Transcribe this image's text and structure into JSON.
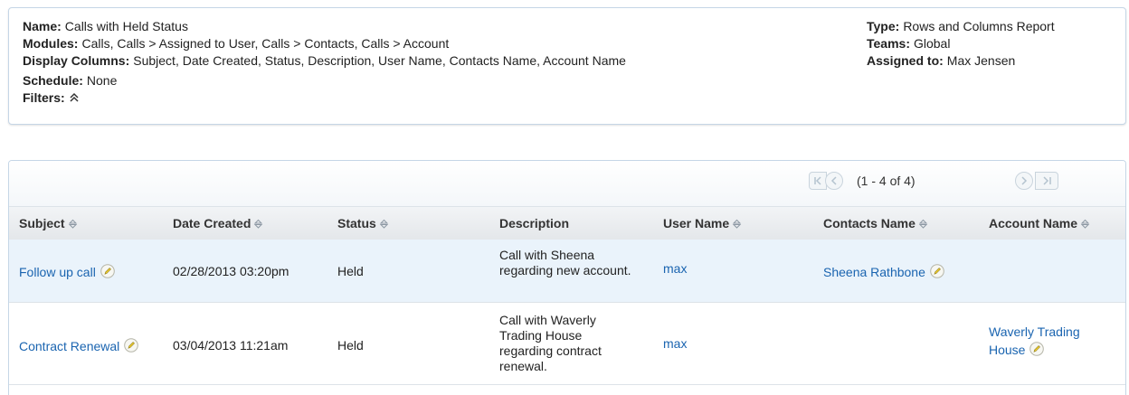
{
  "details": {
    "name_label": "Name:",
    "name": "Calls with Held Status",
    "modules_label": "Modules:",
    "modules": "Calls, Calls > Assigned to User, Calls > Contacts, Calls > Account",
    "display_columns_label": "Display Columns:",
    "display_columns": "Subject, Date Created, Status, Description, User Name, Contacts Name, Account Name",
    "schedule_label": "Schedule:",
    "schedule": "None",
    "filters_label": "Filters:",
    "type_label": "Type:",
    "type": "Rows and Columns Report",
    "teams_label": "Teams:",
    "teams": "Global",
    "assigned_label": "Assigned to:",
    "assigned": "Max Jensen"
  },
  "pager": {
    "range": "(1 - 4 of 4)",
    "first_icon": "first-page-icon",
    "prev_icon": "previous-page-icon",
    "next_icon": "next-page-icon",
    "last_icon": "last-page-icon"
  },
  "columns": {
    "subject": "Subject",
    "date_created": "Date Created",
    "status": "Status",
    "description": "Description",
    "user_name": "User Name",
    "contacts_name": "Contacts Name",
    "account_name": "Account Name"
  },
  "rows": [
    {
      "subject": "Follow up call",
      "date_created": "02/28/2013 03:20pm",
      "status": "Held",
      "description": "Call with Sheena regarding new account.",
      "user_name": "max",
      "contacts_name": "Sheena Rathbone",
      "account_name": ""
    },
    {
      "subject": "Contract Renewal",
      "date_created": "03/04/2013 11:21am",
      "status": "Held",
      "description": "Call with Waverly Trading House regarding contract renewal.",
      "user_name": "max",
      "contacts_name": "",
      "account_name": "Waverly Trading House"
    }
  ],
  "colors": {
    "link": "#1a64b0",
    "selected_row": "#eaf3fb",
    "panel_border": "#c5d6e6"
  }
}
